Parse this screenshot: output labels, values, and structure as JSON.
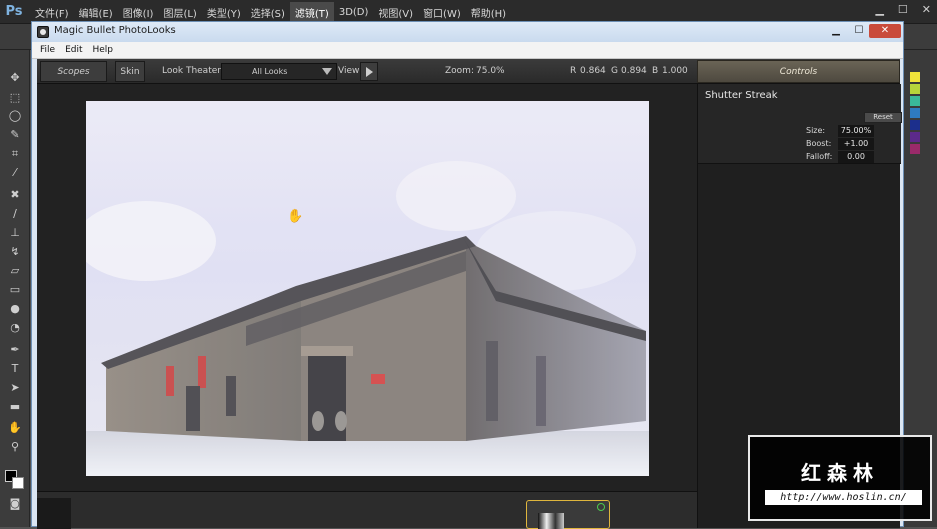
{
  "photoshop": {
    "logo": "Ps",
    "menu": [
      "文件(F)",
      "编辑(E)",
      "图像(I)",
      "图层(L)",
      "类型(Y)",
      "选择(S)",
      "滤镜(T)",
      "3D(D)",
      "视图(V)",
      "窗口(W)",
      "帮助(H)"
    ],
    "active_menu_index": 6,
    "window_controls": [
      "▁",
      "☐",
      "✕"
    ]
  },
  "plugin": {
    "title": "Magic Bullet PhotoLooks",
    "menu": [
      "File",
      "Edit",
      "Help"
    ],
    "title_controls": [
      "▁",
      "☐",
      "✕"
    ],
    "toolbar": {
      "scopes": "Scopes",
      "skin": "Skin",
      "look_theater": "Look Theater",
      "looks_dropdown": "All Looks",
      "view": "View",
      "zoom_label": "Zoom:",
      "zoom_value": "75.0%",
      "r_label": "R",
      "r_value": "0.864",
      "g_label": "G",
      "g_value": "0.894",
      "b_label": "B",
      "b_value": "1.000",
      "controls": "Controls"
    },
    "controls_panel": {
      "tool_name": "Shutter Streak",
      "reset_label": "Reset",
      "params": [
        {
          "label": "Size:",
          "value": "75.00%"
        },
        {
          "label": "Boost:",
          "value": "+1.00"
        },
        {
          "label": "Falloff:",
          "value": "0.00"
        }
      ]
    }
  },
  "watermark": {
    "title": "红森林",
    "url": "http://www.hoslin.cn/"
  },
  "colors": {
    "accent_tile_border": "#dfb63d",
    "power_icon": "#4ec94e",
    "controls_header": "#6a6456"
  }
}
